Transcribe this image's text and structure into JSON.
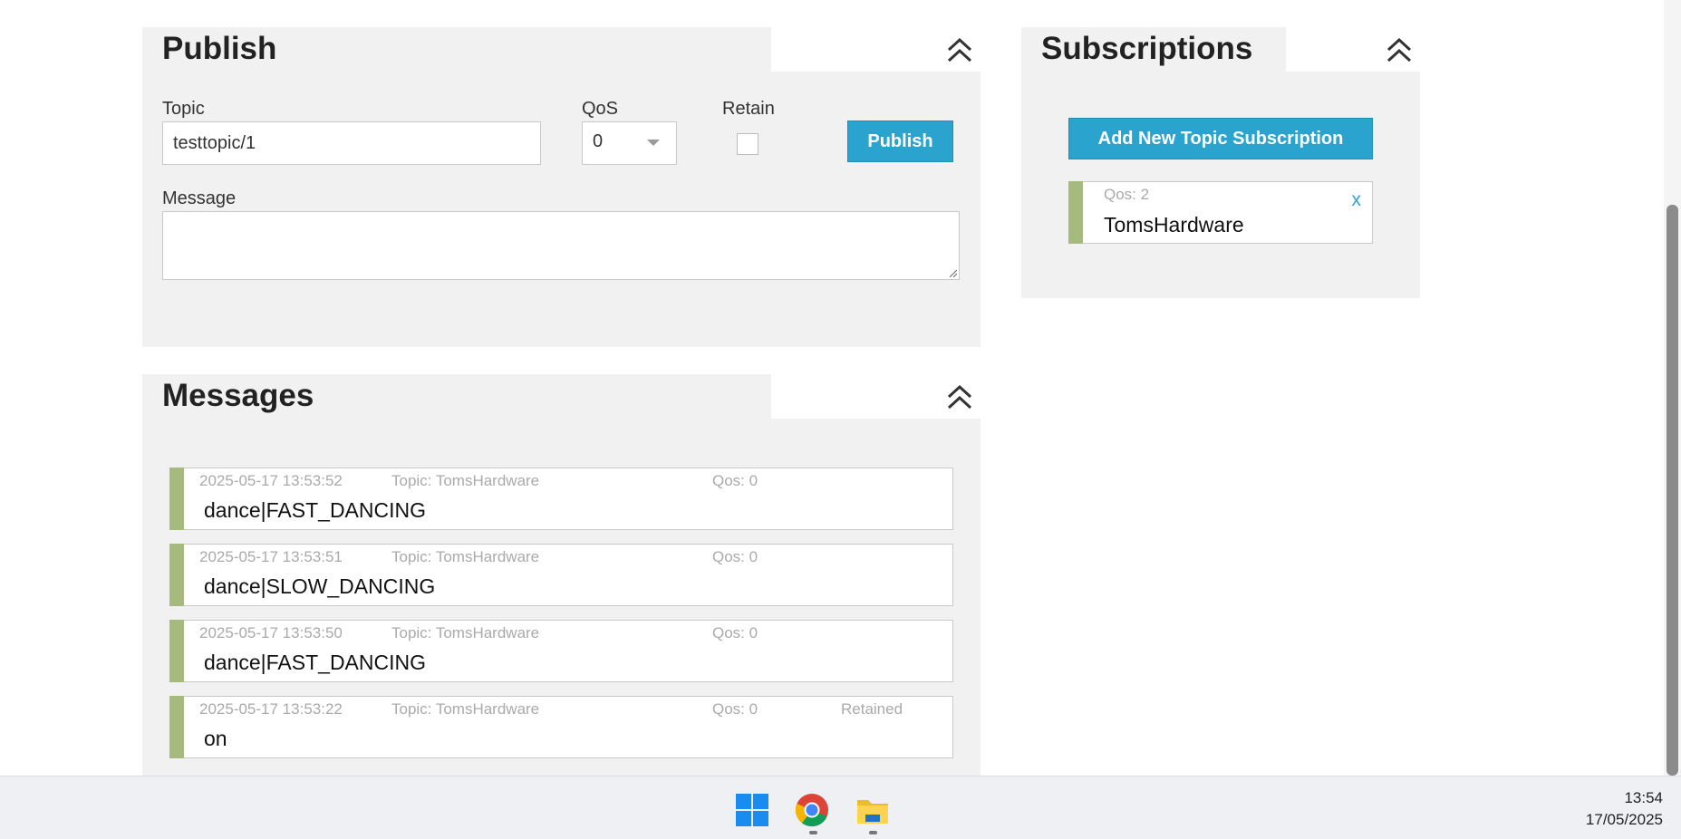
{
  "publish": {
    "title": "Publish",
    "topic_label": "Topic",
    "topic_value": "testtopic/1",
    "qos_label": "QoS",
    "qos_value": "0",
    "retain_label": "Retain",
    "retain_checked": false,
    "publish_button": "Publish",
    "message_label": "Message",
    "message_value": ""
  },
  "subscriptions": {
    "title": "Subscriptions",
    "add_button": "Add New Topic Subscription",
    "items": [
      {
        "qos": "Qos: 2",
        "topic": "TomsHardware",
        "remove": "x"
      }
    ]
  },
  "messages": {
    "title": "Messages",
    "items": [
      {
        "timestamp": "2025-05-17 13:53:52",
        "topic": "Topic: TomsHardware",
        "qos": "Qos: 0",
        "retained": "",
        "payload": "dance|FAST_DANCING"
      },
      {
        "timestamp": "2025-05-17 13:53:51",
        "topic": "Topic: TomsHardware",
        "qos": "Qos: 0",
        "retained": "",
        "payload": "dance|SLOW_DANCING"
      },
      {
        "timestamp": "2025-05-17 13:53:50",
        "topic": "Topic: TomsHardware",
        "qos": "Qos: 0",
        "retained": "",
        "payload": "dance|FAST_DANCING"
      },
      {
        "timestamp": "2025-05-17 13:53:22",
        "topic": "Topic: TomsHardware",
        "qos": "Qos: 0",
        "retained": "Retained",
        "payload": "on"
      }
    ]
  },
  "colors": {
    "accent": "#2aa4cf",
    "message_bar": "#a6b97f",
    "panel_bg": "#f1f1f1"
  },
  "taskbar": {
    "icons": [
      "windows-start-icon",
      "chrome-icon",
      "file-explorer-icon"
    ],
    "time": "13:54",
    "date": "17/05/2025"
  }
}
